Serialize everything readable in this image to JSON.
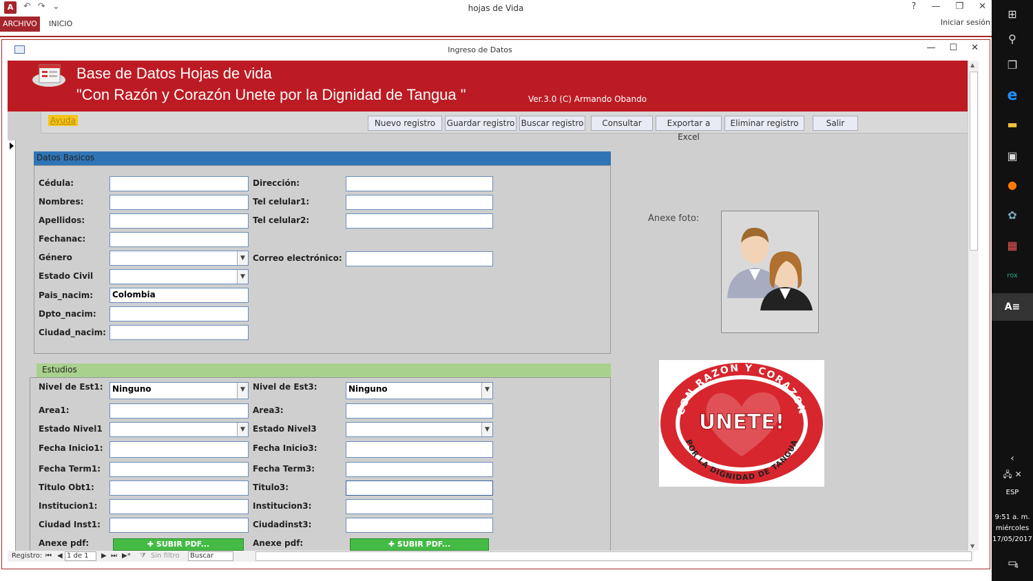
{
  "app": {
    "title": "hojas de Vida",
    "tabs": [
      "ARCHIVO",
      "INICIO"
    ],
    "signin": "Iniciar sesión",
    "help_q": "?",
    "win_min": "—",
    "win_restore": "❐",
    "win_close": "✕"
  },
  "form": {
    "title": "Ingreso de Datos",
    "header_title": "Base de Datos Hojas de vida",
    "header_subtitle": "\"Con Razón y Corazón Unete por la Dignidad de Tangua \"",
    "version": "Ver.3.0 (C) Armando Obando",
    "help": "Ayuda",
    "buttons": [
      "Nuevo registro",
      "Guardar registro",
      "Buscar registro",
      "Consultar",
      "Exportar a Excel",
      "Eliminar registro",
      "Salir"
    ]
  },
  "basicos": {
    "heading": "Datos Basicos",
    "left": [
      {
        "label": "Cédula:",
        "value": ""
      },
      {
        "label": "Nombres:",
        "value": ""
      },
      {
        "label": "Apellidos:",
        "value": ""
      },
      {
        "label": "Fechanac:",
        "value": ""
      },
      {
        "label": "Género",
        "value": ""
      },
      {
        "label": "Estado Civil",
        "value": ""
      },
      {
        "label": "Pais_nacim:",
        "value": "Colombia"
      },
      {
        "label": "Dpto_nacim:",
        "value": ""
      },
      {
        "label": "Ciudad_nacim:",
        "value": ""
      }
    ],
    "right": [
      {
        "label": "Dirección:",
        "value": ""
      },
      {
        "label": "Tel celular1:",
        "value": ""
      },
      {
        "label": "Tel celular2:",
        "value": ""
      },
      {
        "label": "Correo electrónico:",
        "value": ""
      }
    ]
  },
  "estudios": {
    "heading": "Estudios",
    "left": [
      {
        "label": "Nivel de Est1:",
        "value": "Ninguno"
      },
      {
        "label": "Area1:",
        "value": ""
      },
      {
        "label": "Estado Nivel1",
        "value": ""
      },
      {
        "label": "Fecha Inicio1:",
        "value": ""
      },
      {
        "label": "Fecha Term1:",
        "value": ""
      },
      {
        "label": "Titulo Obt1:",
        "value": ""
      },
      {
        "label": "Institucion1:",
        "value": ""
      },
      {
        "label": "Ciudad Inst1:",
        "value": ""
      },
      {
        "label": "Anexe pdf:",
        "value": ""
      }
    ],
    "right": [
      {
        "label": "Nivel de Est3:",
        "value": "Ninguno"
      },
      {
        "label": "Area3:",
        "value": ""
      },
      {
        "label": "Estado Nivel3",
        "value": ""
      },
      {
        "label": "Fecha Inicio3:",
        "value": ""
      },
      {
        "label": "Fecha Term3:",
        "value": ""
      },
      {
        "label": "Titulo3:",
        "value": ""
      },
      {
        "label": "Institucion3:",
        "value": ""
      },
      {
        "label": "Ciudadinst3:",
        "value": ""
      },
      {
        "label": "Anexe pdf:",
        "value": ""
      }
    ],
    "upload_label": "✚ SUBIR PDF..."
  },
  "photo": {
    "label": "Anexe foto:"
  },
  "logo": {
    "top": "CON RAZON Y CORAZON",
    "center": "UNETE!",
    "bottom": "POR LA DIGNIDAD DE TANGUA"
  },
  "navbar": {
    "label": "Registro:",
    "position": "1 de 1",
    "filter": "Sin filtro",
    "search": "Buscar"
  },
  "taskbar": {
    "lang": "ESP",
    "time": "9:51 a. m.",
    "day": "miércoles",
    "date": "17/05/2017",
    "notif": "4"
  }
}
